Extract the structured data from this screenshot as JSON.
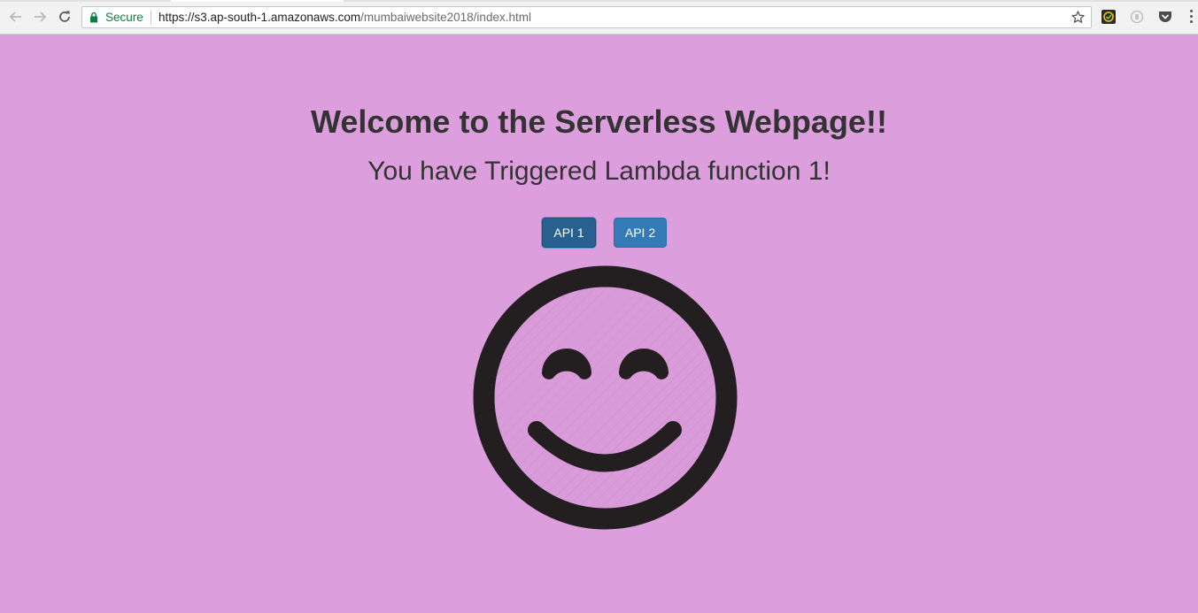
{
  "browser": {
    "secure_label": "Secure",
    "url_host": "https://s3.ap-south-1.amazonaws.com",
    "url_path": "/mumbaiwebsite2018/index.html",
    "icons": [
      "back-arrow-icon",
      "forward-arrow-icon",
      "reload-icon",
      "lock-icon",
      "star-icon",
      "extension-icons",
      "menu-icon"
    ]
  },
  "page": {
    "title": "Welcome to the Serverless Webpage!!",
    "subtitle": "You have Triggered Lambda function 1!",
    "buttons": [
      {
        "label": "API 1"
      },
      {
        "label": "API 2"
      }
    ],
    "image": "smiley-face-icon"
  },
  "colors": {
    "background": "#dc9edc",
    "button_active": "#286090",
    "button": "#337ab7",
    "smiley_stroke": "#231f20"
  }
}
